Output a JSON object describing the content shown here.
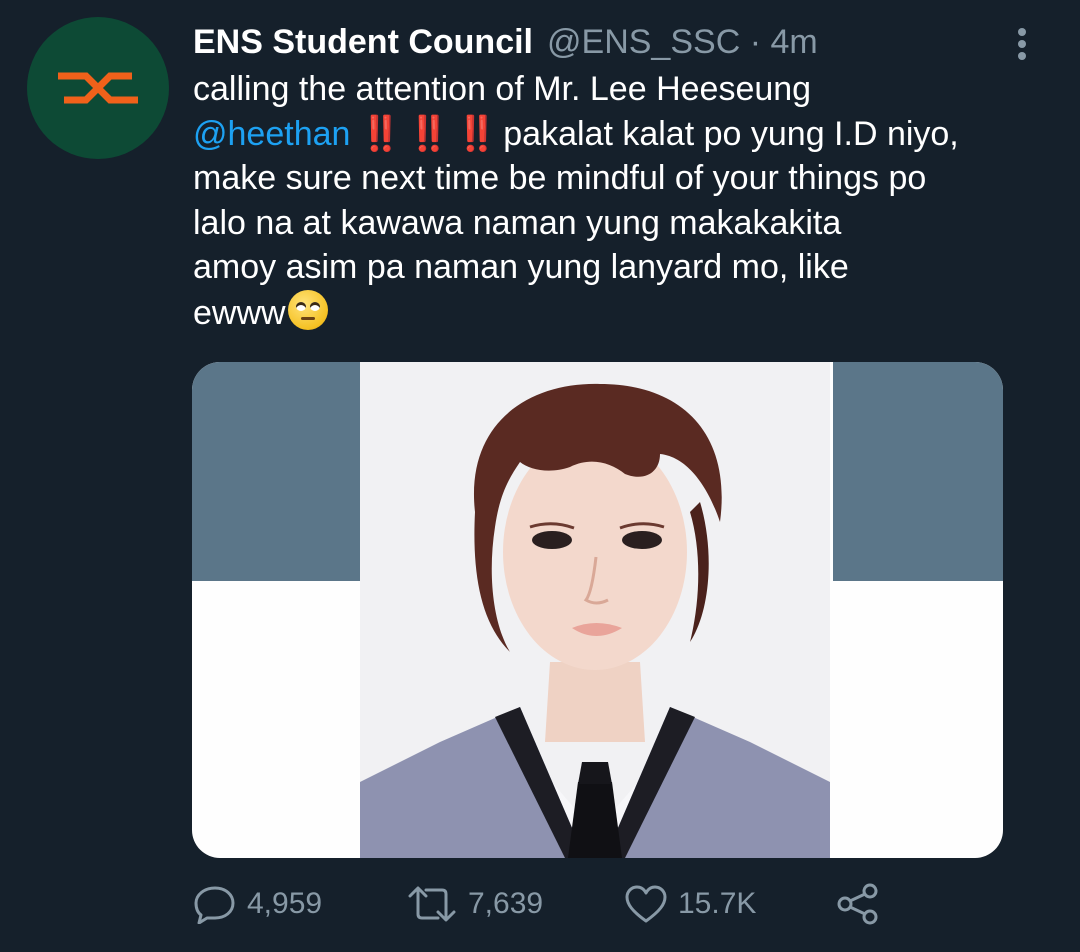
{
  "tweet": {
    "author_name": "ENS Student Council",
    "author_handle": "@ENS_SSC",
    "separator": "·",
    "time": "4m",
    "text_line1": "calling the attention of Mr. Lee Heeseung",
    "mention": "@heethan",
    "exclaim": "‼️",
    "text_line2_rest": " pakalat kalat po yung I.D niyo,",
    "text_line3": "make sure next time be mindful of your things po",
    "text_line4": "lalo na at kawawa naman yung makakakita",
    "text_line5": "amoy asim pa naman yung lanyard mo, like",
    "text_line6": "ewww",
    "emoji": "eye-roll-emoji"
  },
  "actions": {
    "replies": "4,959",
    "retweets": "7,639",
    "likes": "15.7K"
  },
  "colors": {
    "background": "#15202b",
    "secondary_text": "#8899a6",
    "mention": "#1da1f2",
    "avatar_bg": "#0d4a35",
    "avatar_logo": "#f0611a"
  },
  "icons": [
    "more-vertical-icon",
    "reply-icon",
    "retweet-icon",
    "like-icon",
    "share-icon"
  ]
}
